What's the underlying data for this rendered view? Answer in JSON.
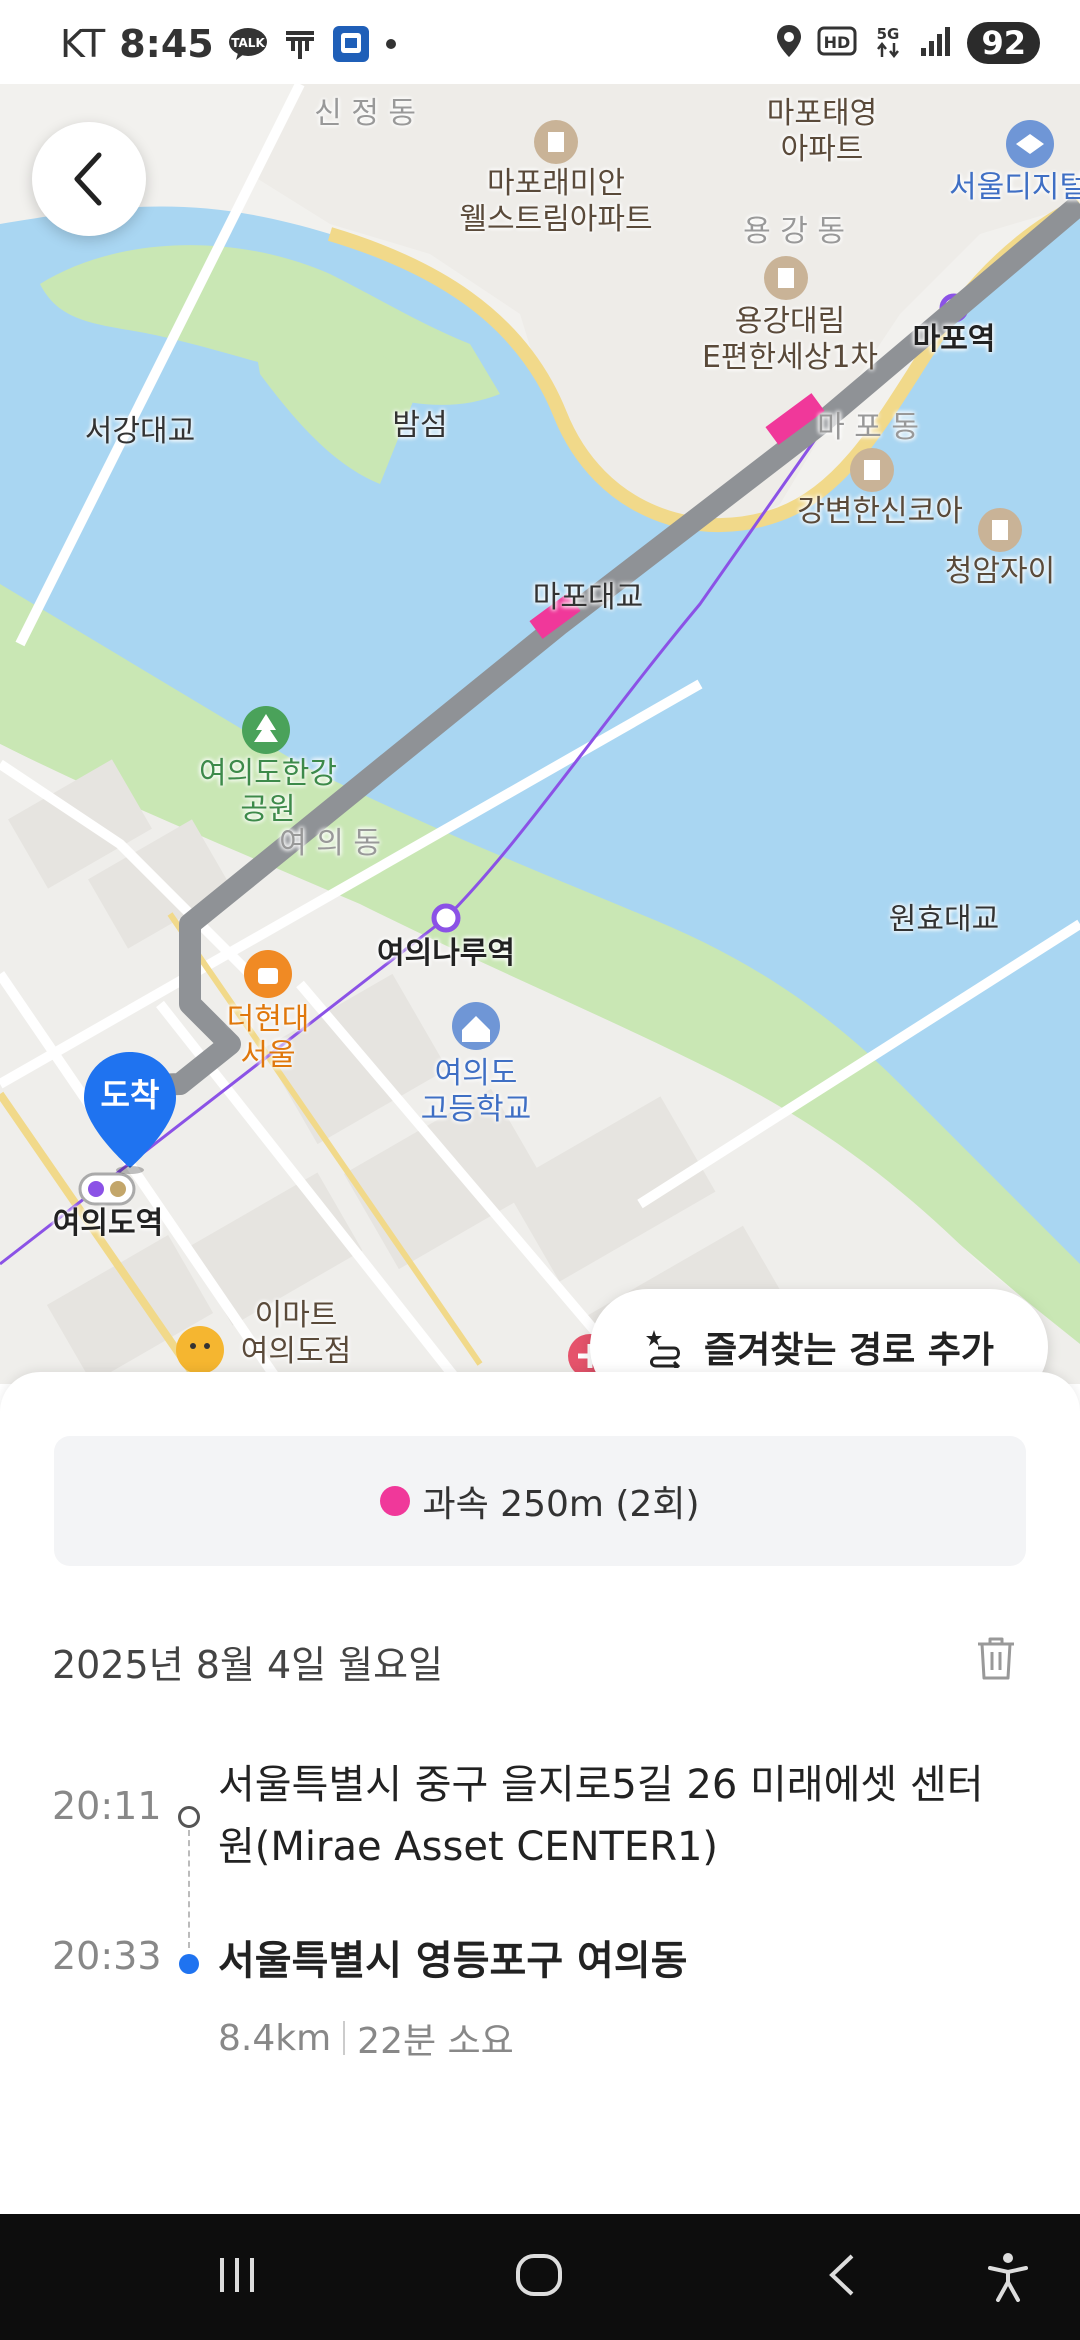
{
  "status_bar": {
    "carrier": "KT",
    "time": "8:45",
    "battery": "92",
    "icons": [
      "talk-icon",
      "t-icon",
      "app-icon",
      "dot-icon",
      "location-icon",
      "hd-icon",
      "5g-icon",
      "signal-icon"
    ]
  },
  "map": {
    "labels": {
      "sinjeong": "신 정 동",
      "mapo_taeyoung": "마포태영\n아파트",
      "mapo_raemian": "마포래미안\n웰스트림아파트",
      "seoul_digital": "서울디지털",
      "yonggang": "용 강 동",
      "yonggang_daelim": "용강대림\nE편한세상1차",
      "mapo_station": "마포역",
      "bamseom": "밤섬",
      "seogang_bridge": "서강대교",
      "mapo_dong": "마 포 동",
      "gangbyeon": "강변한신코아",
      "cheongam": "청암자이",
      "mapo_bridge": "마포대교",
      "yeouido_park": "여의도한강\n공원",
      "yeoui_dong": "여 의 동",
      "yeouinaru": "여의나루역",
      "wonhyo_bridge": "원효대교",
      "hyundai": "더현대\n서울",
      "yeouido_highschool": "여의도\n고등학교",
      "yeouido_station": "여의도역",
      "emart": "이마트\n여의도점"
    },
    "arrival_pin": "도착",
    "colors": {
      "water": "#a9d6f2",
      "park": "#c9e7b4",
      "route": "#8f9296",
      "speeding": "#f0389a",
      "subway5": "#8b52e6",
      "pin": "#1f73f0"
    }
  },
  "favorite_route_button": {
    "label": "즐겨찾는 경로 추가",
    "icon": "route-star-icon"
  },
  "trip": {
    "speeding_summary": "과속 250m (2회)",
    "date": "2025년 8월 4일 월요일",
    "start": {
      "time": "20:11",
      "address": "서울특별시 중구 을지로5길 26 미래에셋 센터원(Mirae Asset CENTER1)"
    },
    "end": {
      "time": "20:33",
      "address": "서울특별시 영등포구 여의동"
    },
    "distance": "8.4km",
    "duration": "22분 소요"
  },
  "nav_bar": {
    "icons": [
      "recents-icon",
      "home-icon",
      "back-icon",
      "accessibility-icon"
    ]
  }
}
